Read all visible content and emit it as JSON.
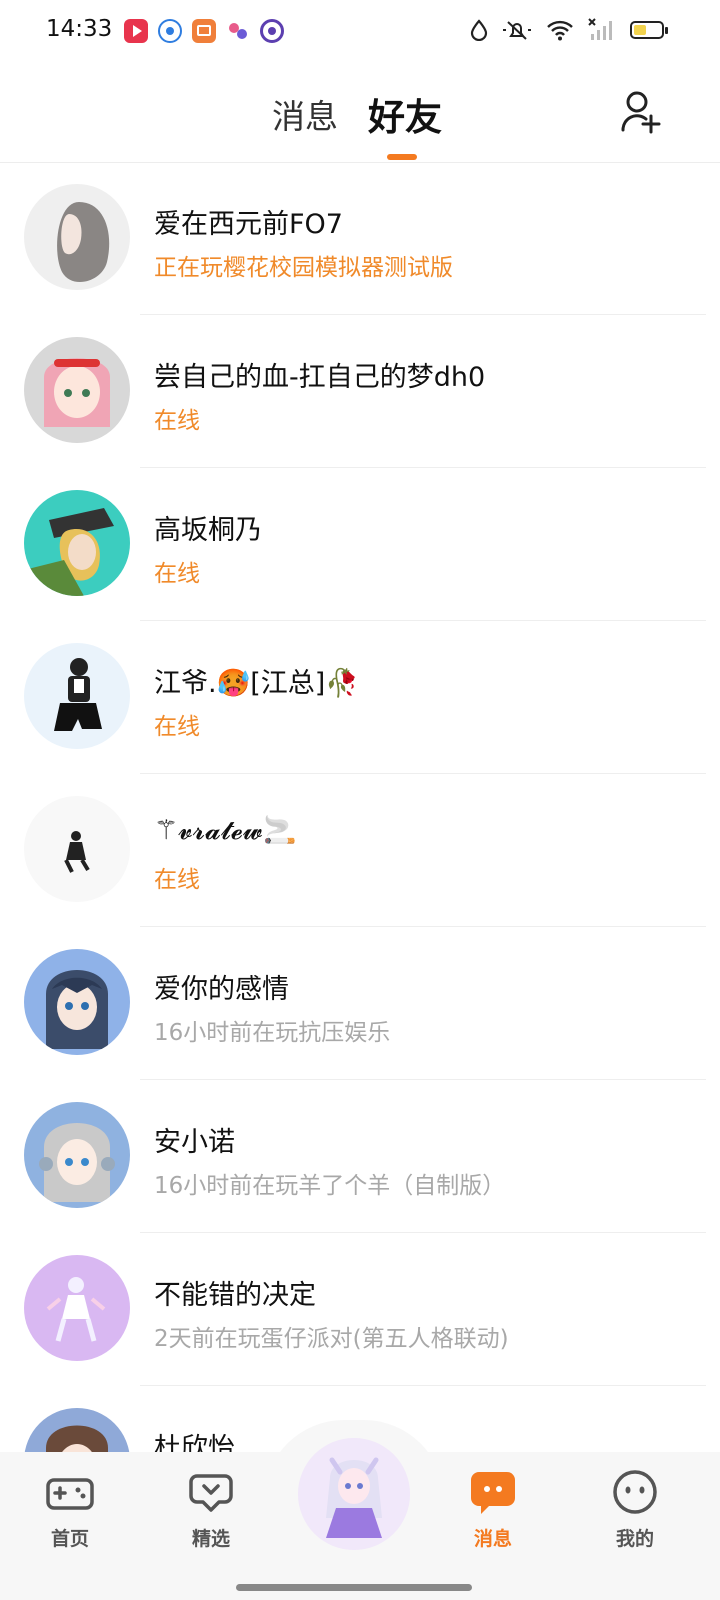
{
  "status_bar": {
    "time": "14:33",
    "battery_level": 0.45,
    "notification_icons": [
      "video-app-icon",
      "browser-app-icon",
      "reader-app-icon",
      "game-center-icon",
      "tracker-app-icon"
    ],
    "system_icons": [
      "water-drop-icon",
      "mute-icon",
      "wifi-icon",
      "no-signal-icon",
      "battery-icon"
    ]
  },
  "header": {
    "tabs": [
      {
        "label": "消息",
        "selected": false
      },
      {
        "label": "好友",
        "selected": true
      }
    ],
    "add_friend_icon": "add-friend-icon",
    "accent_color": "#f47a20"
  },
  "friends": [
    {
      "name": "爱在西元前FO7",
      "status": "正在玩樱花校园模拟器测试版",
      "state": "active"
    },
    {
      "name": "尝自己的血-扛自己的梦dh0",
      "status": "在线",
      "state": "active"
    },
    {
      "name": "高坂桐乃",
      "status": "在线",
      "state": "active"
    },
    {
      "name": "江爷.🥵[江总]🥀",
      "status": "在线",
      "state": "active"
    },
    {
      "name": "⚚𝓿𝓻𝓪𝓽𝓮𝔀🚬",
      "status": "在线",
      "state": "active"
    },
    {
      "name": "爱你的感情",
      "status": "16小时前在玩抗压娱乐",
      "state": "idle"
    },
    {
      "name": "安小诺",
      "status": "16小时前在玩羊了个羊（自制版）",
      "state": "idle"
    },
    {
      "name": "不能错的决定",
      "status": "2天前在玩蛋仔派对(第五人格联动)",
      "state": "idle"
    },
    {
      "name": "杜欣怡",
      "status": "",
      "state": "idle"
    }
  ],
  "bottom_nav": [
    {
      "label": "首页",
      "icon": "gamepad-icon",
      "selected": false
    },
    {
      "label": "精选",
      "icon": "heart-chat-icon",
      "selected": false
    },
    {
      "label": "消息",
      "icon": "message-icon",
      "selected": true
    },
    {
      "label": "我的",
      "icon": "face-icon",
      "selected": false
    }
  ]
}
